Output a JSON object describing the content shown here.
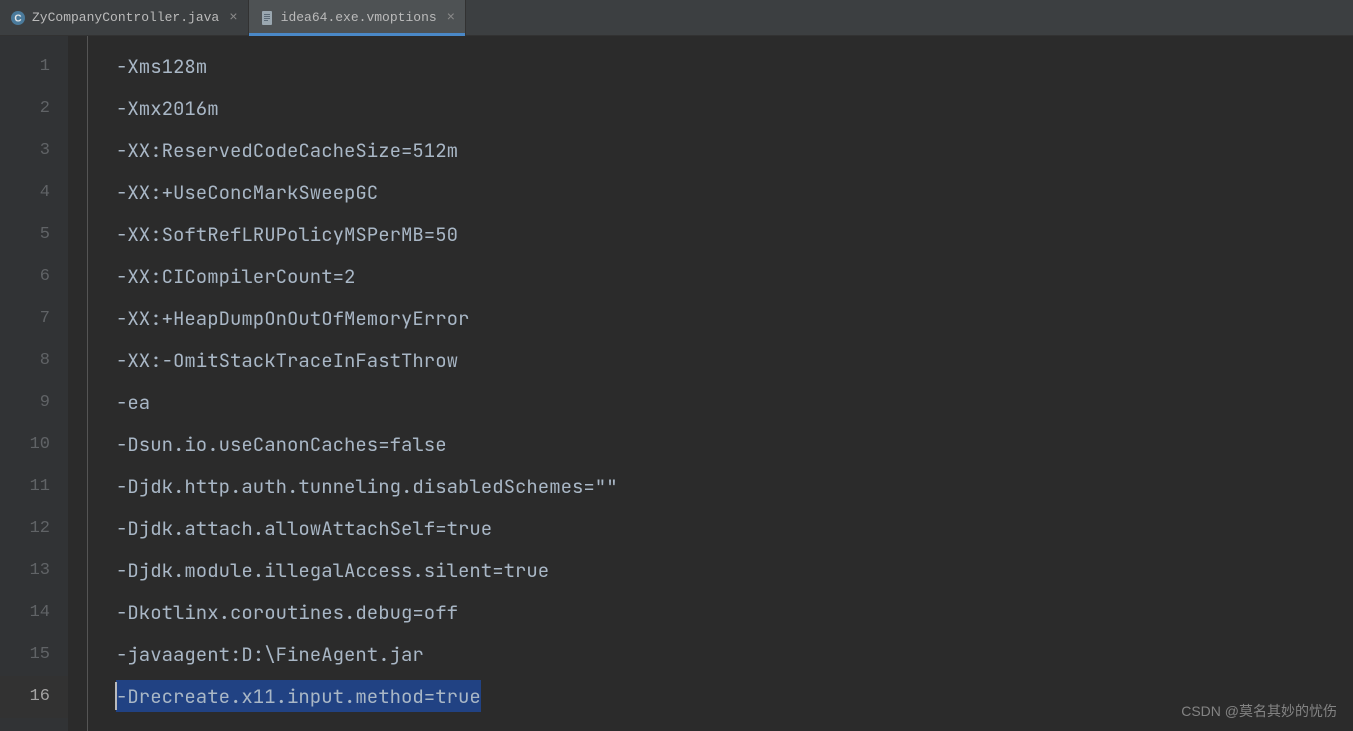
{
  "tabs": [
    {
      "label": "ZyCompanyController.java",
      "icon": "java-class-icon",
      "active": false
    },
    {
      "label": "idea64.exe.vmoptions",
      "icon": "text-file-icon",
      "active": true
    }
  ],
  "editor": {
    "lines": [
      {
        "num": "1",
        "text": "-Xms128m"
      },
      {
        "num": "2",
        "text": "-Xmx2016m"
      },
      {
        "num": "3",
        "text": "-XX:ReservedCodeCacheSize=512m"
      },
      {
        "num": "4",
        "text": "-XX:+UseConcMarkSweepGC"
      },
      {
        "num": "5",
        "text": "-XX:SoftRefLRUPolicyMSPerMB=50"
      },
      {
        "num": "6",
        "text": "-XX:CICompilerCount=2"
      },
      {
        "num": "7",
        "text": "-XX:+HeapDumpOnOutOfMemoryError"
      },
      {
        "num": "8",
        "text": "-XX:-OmitStackTraceInFastThrow"
      },
      {
        "num": "9",
        "text": "-ea"
      },
      {
        "num": "10",
        "text": "-Dsun.io.useCanonCaches=false"
      },
      {
        "num": "11",
        "text": "-Djdk.http.auth.tunneling.disabledSchemes=\"\""
      },
      {
        "num": "12",
        "text": "-Djdk.attach.allowAttachSelf=true"
      },
      {
        "num": "13",
        "text": "-Djdk.module.illegalAccess.silent=true"
      },
      {
        "num": "14",
        "text": "-Dkotlinx.coroutines.debug=off"
      },
      {
        "num": "15",
        "text": "-javaagent:D:\\FineAgent.jar"
      },
      {
        "num": "16",
        "text": "-Drecreate.x11.input.method=true"
      }
    ],
    "selected_line_index": 15,
    "selection_width_ch": 32
  },
  "watermark": "CSDN @莫名其妙的忧伤"
}
